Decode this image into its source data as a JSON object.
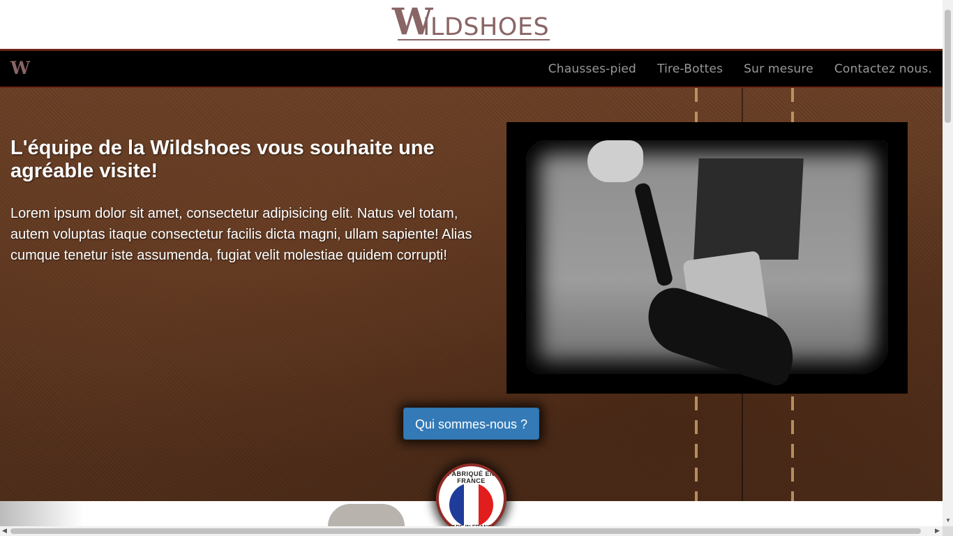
{
  "header": {
    "logo_initial": "W",
    "logo_rest": "ILDSHOES"
  },
  "navbar": {
    "brand": "W",
    "links": [
      {
        "label": "Chausses-pied"
      },
      {
        "label": "Tire-Bottes"
      },
      {
        "label": "Sur mesure"
      },
      {
        "label": "Contactez nous."
      }
    ]
  },
  "hero": {
    "title": "L'équipe de la Wildshoes vous souhaite une agréable visite!",
    "text": "Lorem ipsum dolor sit amet, consectetur adipisicing elit. Natus vel totam, autem voluptas itaque consectetur facilis dicta magni, ullam sapiente! Alias cumque tenetur iste assumenda, fugiat velit molestiae quidem corrupti!",
    "cta_label": "Qui sommes-nous ?"
  },
  "badge": {
    "top_text": "FABRIQUÉ EN FRANCE",
    "bottom_text": "MADE IN FRANCE",
    "colors": [
      "#1f3c9b",
      "#ffffff",
      "#e11d1d"
    ]
  },
  "colors": {
    "brand": "#8a6566",
    "navbar_border": "#6b2416",
    "button": "#337ab7"
  }
}
